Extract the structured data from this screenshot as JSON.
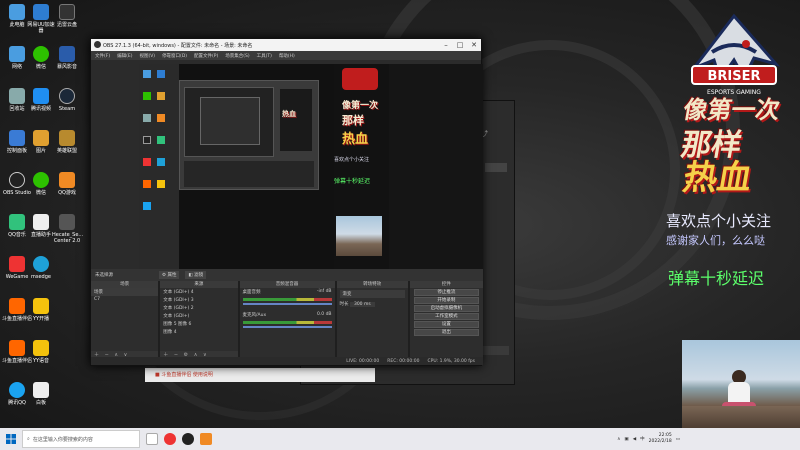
{
  "desktop": {
    "icons": [
      {
        "label": "此电脑",
        "color": "#4a9de0"
      },
      {
        "label": "网易UU加速器",
        "color": "#2e7dd1"
      },
      {
        "label": "迅雷云盘",
        "color": "#333"
      },
      {
        "label": "网络",
        "color": "#4a9de0"
      },
      {
        "label": "微信",
        "color": "#2dc100"
      },
      {
        "label": "暴风影音",
        "color": "#2a5caa"
      },
      {
        "label": "回收站",
        "color": "#8aa"
      },
      {
        "label": "腾讯视频",
        "color": "#1f8ef1"
      },
      {
        "label": "Steam",
        "color": "#1b2838"
      },
      {
        "label": "控制面板",
        "color": "#3a7bd5"
      },
      {
        "label": "图片",
        "color": "#e0a030"
      },
      {
        "label": "英雄联盟",
        "color": "#b88a2e"
      },
      {
        "label": "OBS Studio",
        "color": "#222"
      },
      {
        "label": "微信",
        "color": "#2dc100"
      },
      {
        "label": "QQ游戏",
        "color": "#f08a24"
      },
      {
        "label": "QQ音乐",
        "color": "#31c27c"
      },
      {
        "label": "直播助手",
        "color": "#eee"
      },
      {
        "label": "Hecate_Se... Center 2.0",
        "color": "#555"
      },
      {
        "label": "WeGame",
        "color": "#e33"
      },
      {
        "label": "msedge",
        "color": "#1ea1d8"
      },
      {
        "label": "斗鱼直播伴侣",
        "color": "#f60"
      },
      {
        "label": "YY开播",
        "color": "#f4c20d"
      },
      {
        "label": "斗鱼直播伴侣",
        "color": "#f60"
      },
      {
        "label": "YY语音",
        "color": "#f4c20d"
      },
      {
        "label": "腾讯QQ",
        "color": "#1aa3f0"
      },
      {
        "label": "白板",
        "color": "#eee"
      }
    ]
  },
  "overlay": {
    "logo_text": "BRISER",
    "logo_sub": "ESPORTS GAMING",
    "title_line1": "像第一次",
    "title_line2": "那样",
    "title_line3": "热血",
    "welcome_line1": "喜欢点个小关注",
    "welcome_line2": "感谢家人们，么么哒",
    "delay_notice": "弹幕十秒延迟"
  },
  "obs": {
    "title": "OBS 27.1.3 (64-bit, windows) - 配置文件: 未命名 - 场景: 未命名",
    "menu": [
      "文件(F)",
      "编辑(E)",
      "视图(V)",
      "停靠窗口(D)",
      "配置文件(P)",
      "场景集合(S)",
      "工具(T)",
      "帮助(H)"
    ],
    "toolbar": {
      "label": "未选择源",
      "properties": "属性",
      "filters": "滤镜"
    },
    "docks": {
      "scenes": {
        "title": "场景",
        "items": [
          "场景",
          "C7"
        ]
      },
      "sources": {
        "title": "来源",
        "items": [
          "文本 (GDI+) 4",
          "文本 (GDI+) 3",
          "文本 (GDI+) 2",
          "文本 (GDI+)",
          "图像 5 图像 6",
          "图像 4",
          "图像 3"
        ]
      },
      "mixer": {
        "title": "音频混音器",
        "channels": [
          {
            "name": "桌面音频",
            "db": "-inf dB"
          },
          {
            "name": "麦克风/Aux",
            "db": "0.0 dB"
          }
        ]
      },
      "transitions": {
        "title": "转场特效",
        "type": "渐变",
        "duration_label": "时长",
        "duration": "300 ms"
      },
      "controls": {
        "title": "控件",
        "buttons": [
          "停止推流",
          "开始录制",
          "启动虚拟摄像机",
          "工作室模式",
          "设置",
          "退出"
        ]
      }
    },
    "status": {
      "live": "LIVE: 00:00:00",
      "rec": "REC: 00:00:00",
      "cpu": "CPU: 1.9%, 30.00 fps"
    }
  },
  "notice_bar": {
    "text": "斗鱼直播伴侣 使用说明"
  },
  "taskbar": {
    "search_placeholder": "在这里输入你要搜索的内容",
    "clock_time": "22:05",
    "clock_date": "2022/2/18",
    "language": "中"
  }
}
